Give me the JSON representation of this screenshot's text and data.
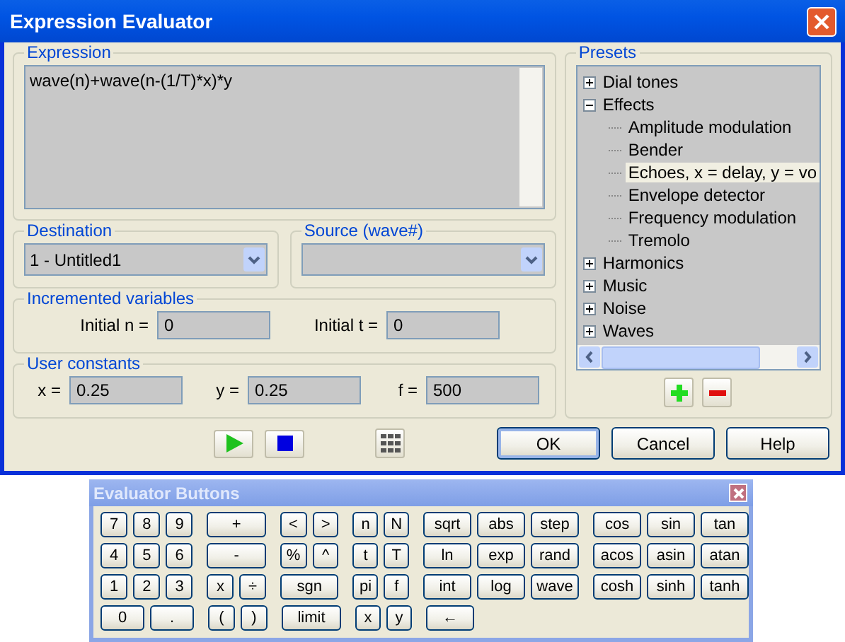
{
  "window": {
    "title": "Expression Evaluator"
  },
  "expression": {
    "legend": "Expression",
    "value": "wave(n)+wave(n-(1/T)*x)*y"
  },
  "destination": {
    "legend": "Destination",
    "value": "1 - Untitled1"
  },
  "source": {
    "legend": "Source (wave#)"
  },
  "incremented_variables": {
    "legend": "Incremented variables",
    "fields": [
      {
        "label": "Initial n =",
        "value": "0"
      },
      {
        "label": "Initial t =",
        "value": "0"
      }
    ]
  },
  "user_constants": {
    "legend": "User constants",
    "fields": [
      {
        "label": "x =",
        "value": "0.25"
      },
      {
        "label": "y =",
        "value": "0.25"
      },
      {
        "label": "f =",
        "value": "500"
      }
    ]
  },
  "presets": {
    "legend": "Presets",
    "tree": [
      {
        "label": "Dial tones",
        "expanded": false
      },
      {
        "label": "Effects",
        "expanded": true,
        "children": [
          {
            "label": "Amplitude modulation",
            "selected": false
          },
          {
            "label": "Bender",
            "selected": false
          },
          {
            "label": "Echoes, x = delay, y = vo",
            "selected": true
          },
          {
            "label": "Envelope detector",
            "selected": false
          },
          {
            "label": "Frequency modulation",
            "selected": false
          },
          {
            "label": "Tremolo",
            "selected": false
          }
        ]
      },
      {
        "label": "Harmonics",
        "expanded": false
      },
      {
        "label": "Music",
        "expanded": false
      },
      {
        "label": "Noise",
        "expanded": false
      },
      {
        "label": "Waves",
        "expanded": false
      }
    ]
  },
  "buttons": [
    "OK",
    "Cancel",
    "Help"
  ],
  "evaluator_buttons": {
    "title": "Evaluator Buttons",
    "rows": [
      [
        [
          "7",
          "8",
          "9"
        ],
        [
          "+"
        ],
        [
          "<",
          ">"
        ],
        [
          "n",
          "N"
        ],
        [
          "sqrt",
          "abs",
          "step"
        ],
        [
          "cos",
          "sin",
          "tan"
        ]
      ],
      [
        [
          "4",
          "5",
          "6"
        ],
        [
          "-"
        ],
        [
          "%",
          "^"
        ],
        [
          "t",
          "T"
        ],
        [
          "ln",
          "exp",
          "rand"
        ],
        [
          "acos",
          "asin",
          "atan"
        ]
      ],
      [
        [
          "1",
          "2",
          "3"
        ],
        [
          "x",
          "÷"
        ],
        [
          "sgn"
        ],
        [
          "pi",
          "f"
        ],
        [
          "int",
          "log",
          "wave"
        ],
        [
          "cosh",
          "sinh",
          "tanh"
        ]
      ],
      [
        [
          "0",
          "."
        ],
        [
          "(",
          ")"
        ],
        [
          "limit"
        ],
        [
          "x",
          "y"
        ],
        [
          "←"
        ]
      ]
    ]
  }
}
